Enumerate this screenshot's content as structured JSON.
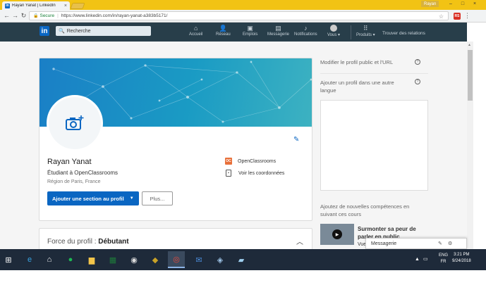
{
  "browser": {
    "tab_title": "Rayan Yanat | LinkedIn",
    "tab_favicon": "in",
    "user_badge": "Rayan",
    "secure_label": "Secure",
    "url": "https://www.linkedin.com/in/rayan-yanat-a383b5171/",
    "ext_label": "RS"
  },
  "nav": {
    "logo": "in",
    "search_placeholder": "Recherche",
    "items": [
      {
        "label": "Accueil",
        "icon": "home-icon",
        "glyph": "⌂"
      },
      {
        "label": "Réseau",
        "icon": "network-icon",
        "glyph": "👥"
      },
      {
        "label": "Emplois",
        "icon": "briefcase-icon",
        "glyph": "💼"
      },
      {
        "label": "Messagerie",
        "icon": "chat-icon",
        "glyph": "▤"
      },
      {
        "label": "Notifications",
        "icon": "bell-icon",
        "glyph": "🔔"
      },
      {
        "label": "Vous ▾",
        "icon": "avatar",
        "glyph": ""
      },
      {
        "label": "Produits ▾",
        "icon": "grid-icon",
        "glyph": "⠿"
      }
    ],
    "relations": "Trouver des relations"
  },
  "profile": {
    "name": "Rayan Yanat",
    "headline": "Étudiant à OpenClassrooms",
    "location": "Région de Paris, France",
    "add_section": "Ajouter une section au profil",
    "more": "Plus...",
    "education": "OpenClassrooms",
    "education_logo": "OC",
    "contact": "Voir les coordonnées"
  },
  "strength": {
    "label": "Force du profil :",
    "value": "Débutant"
  },
  "right": {
    "public_profile": "Modifier le profil public et l'URL",
    "other_language": "Ajouter un profil dans une autre langue",
    "courses_intro": "Ajoutez de nouvelles compétences en suivant ces cours",
    "course_title": "Surmonter sa peur de parler en public",
    "course_sub": "Vue"
  },
  "messaging": {
    "label": "Messagerie"
  },
  "taskbar": {
    "lang": "ENG",
    "region": "FR",
    "time": "3:21 PM",
    "date": "9/24/2018"
  },
  "colors": {
    "linkedin_blue": "#0a66c2",
    "nav_bg": "#283e4a",
    "chrome_accent": "#f2c314"
  }
}
